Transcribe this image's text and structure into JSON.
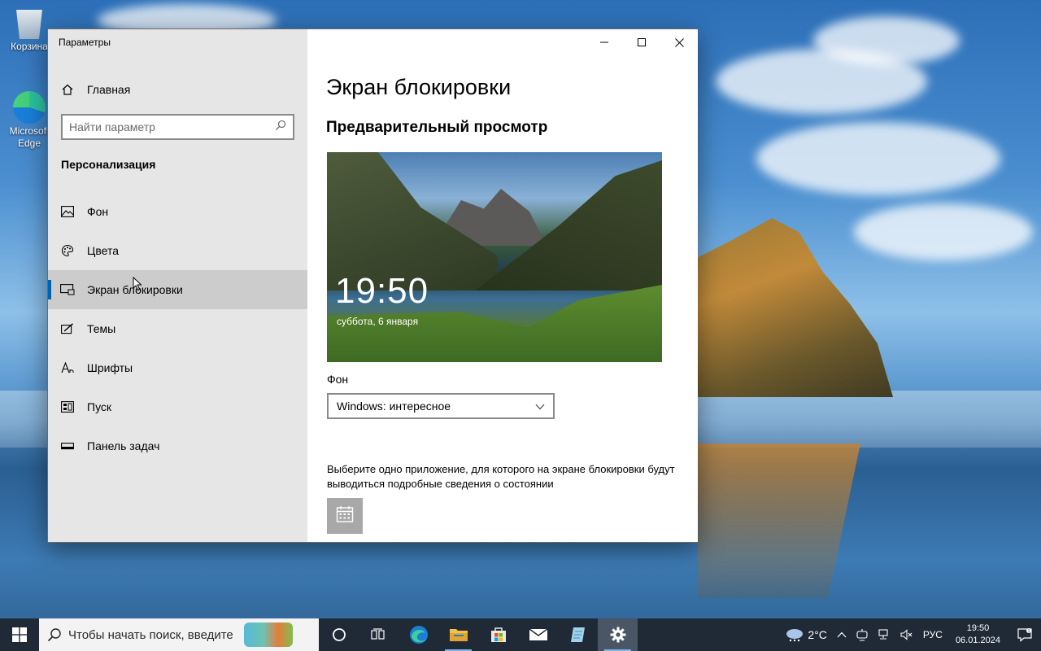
{
  "desktop": {
    "icons": [
      {
        "label": "Корзина",
        "icon": "recycle-bin-icon"
      },
      {
        "label": "Microsoft Edge",
        "icon": "edge-icon"
      }
    ]
  },
  "window": {
    "title": "Параметры",
    "controls": {
      "minimize": "—",
      "maximize": "☐",
      "close": "✕"
    }
  },
  "sidebar": {
    "home_label": "Главная",
    "search": {
      "placeholder": "Найти параметр",
      "value": ""
    },
    "section_title": "Персонализация",
    "items": [
      {
        "label": "Фон",
        "icon": "picture-icon"
      },
      {
        "label": "Цвета",
        "icon": "palette-icon"
      },
      {
        "label": "Экран блокировки",
        "icon": "lock-screen-icon",
        "active": true
      },
      {
        "label": "Темы",
        "icon": "themes-icon"
      },
      {
        "label": "Шрифты",
        "icon": "fonts-icon"
      },
      {
        "label": "Пуск",
        "icon": "start-icon"
      },
      {
        "label": "Панель задач",
        "icon": "taskbar-icon"
      }
    ]
  },
  "main": {
    "title": "Экран блокировки",
    "preview_heading": "Предварительный просмотр",
    "preview": {
      "time": "19:50",
      "date": "суббота, 6 января"
    },
    "background_label": "Фон",
    "background_value": "Windows: интересное",
    "status_desc": "Выберите одно приложение, для которого на экране блокировки будут выводиться подробные сведения о состоянии",
    "status_app_icon": "calendar-icon"
  },
  "taskbar": {
    "search_placeholder": "Чтобы начать поиск, введите",
    "apps": [
      {
        "name": "cortana",
        "icon": "circle-icon"
      },
      {
        "name": "task-view",
        "icon": "task-view-icon"
      },
      {
        "name": "edge",
        "icon": "edge-icon"
      },
      {
        "name": "explorer",
        "icon": "folder-icon"
      },
      {
        "name": "store",
        "icon": "store-icon"
      },
      {
        "name": "mail",
        "icon": "mail-icon"
      },
      {
        "name": "notepad",
        "icon": "notepad-icon"
      },
      {
        "name": "settings",
        "icon": "gear-icon"
      }
    ],
    "weather_temp": "2°C",
    "language": "РУС",
    "time": "19:50",
    "date": "06.01.2024"
  }
}
